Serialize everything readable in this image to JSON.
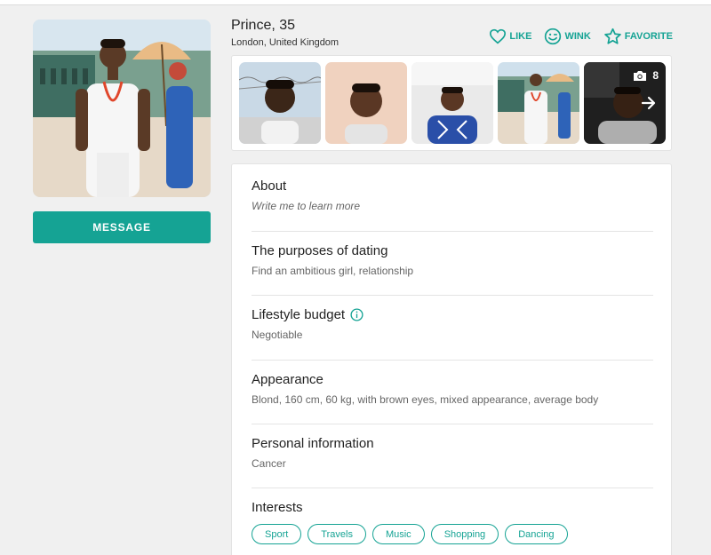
{
  "profile": {
    "name_age": "Prince, 35",
    "location": "London, United Kingdom"
  },
  "actions": {
    "like": "LIKE",
    "wink": "WINK",
    "favorite": "FAVORITE"
  },
  "message_button": "MESSAGE",
  "gallery": {
    "photo_count": "8"
  },
  "sections": {
    "about": {
      "title": "About",
      "text": "Write me to learn more"
    },
    "purposes": {
      "title": "The purposes of dating",
      "text": "Find an ambitious girl, relationship"
    },
    "lifestyle": {
      "title": "Lifestyle budget",
      "text": "Negotiable"
    },
    "appearance": {
      "title": "Appearance",
      "text": "Blond, 160 cm, 60 kg, with brown eyes, mixed appearance, average body"
    },
    "personal": {
      "title": "Personal information",
      "text": "Cancer"
    },
    "interests": {
      "title": "Interests",
      "tags": [
        "Sport",
        "Travels",
        "Music",
        "Shopping",
        "Dancing"
      ]
    }
  },
  "colors": {
    "accent": "#15a394",
    "background": "#f0f0f0"
  }
}
